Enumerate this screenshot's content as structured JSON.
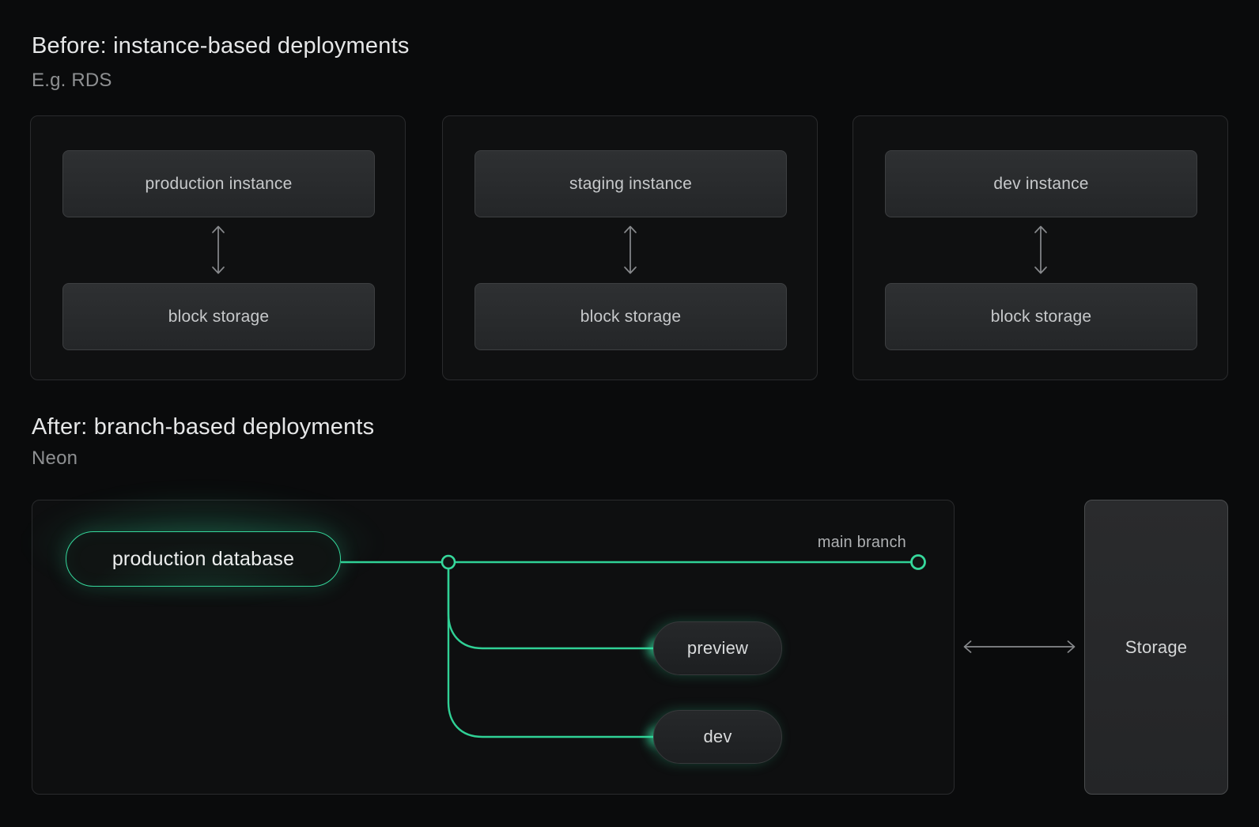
{
  "before": {
    "title": "Before: instance-based deployments",
    "subtitle": "E.g. RDS",
    "cards": [
      {
        "instance": "production instance",
        "storage": "block storage"
      },
      {
        "instance": "staging instance",
        "storage": "block storage"
      },
      {
        "instance": "dev instance",
        "storage": "block storage"
      }
    ]
  },
  "after": {
    "title": "After: branch-based deployments",
    "subtitle": "Neon",
    "production_pill": "production database",
    "main_branch_label": "main branch",
    "branches": [
      {
        "label": "preview"
      },
      {
        "label": "dev"
      }
    ],
    "storage_label": "Storage"
  },
  "colors": {
    "accent_green": "#30d196",
    "background": "#0a0b0c",
    "card_background": "#0f1011",
    "box_border": "#3d3f41",
    "arrow_gray": "#87898c"
  },
  "icons": {
    "vertical_double_arrow": "updown-arrow-icon",
    "horizontal_double_arrow": "leftright-arrow-icon",
    "branch_point": "branch-node-icon",
    "branch_tip": "branch-tip-icon"
  }
}
